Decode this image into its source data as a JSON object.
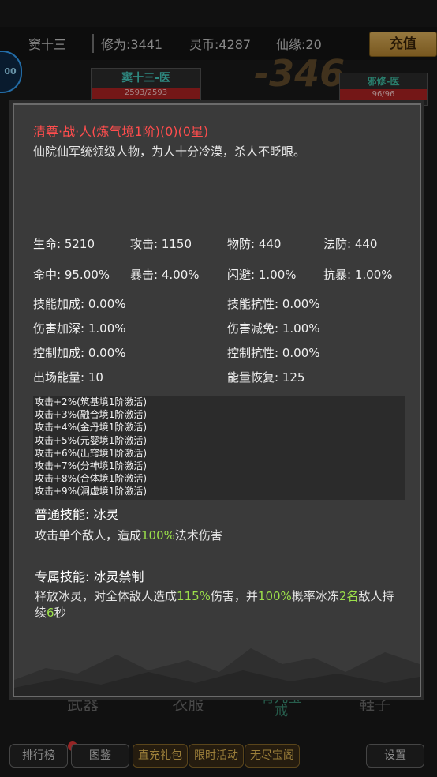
{
  "topbar": {
    "player_name": "窦十三",
    "cultivation": "修为:3441",
    "spirit_coins": "灵币:4287",
    "fate": "仙缘:20",
    "recharge_label": "充值"
  },
  "battle": {
    "round_badge": "00",
    "damage_number": "-346",
    "ally": {
      "name": "窦十三-医",
      "hp": "2593/2593"
    },
    "enemy": {
      "name": "邪修-医",
      "hp": "96/96"
    }
  },
  "bottom_tabs": [
    "武器",
    "衣服",
    "育儿宝戒",
    "鞋子"
  ],
  "bottom_bar": {
    "ranking": "排行榜",
    "codex": "图鉴",
    "gift": "直充礼包",
    "limited": "限时活动",
    "treasure": "无尽宝阁",
    "settings": "设置"
  },
  "detail": {
    "title": "清尊·战·人(炼气境1阶)(0)(0星)",
    "description": "仙院仙军统领级人物，为人十分冷漠，杀人不眨眼。",
    "stats_row1": [
      {
        "label": "生命",
        "value": "5210"
      },
      {
        "label": "攻击",
        "value": "1150"
      },
      {
        "label": "物防",
        "value": "440"
      },
      {
        "label": "法防",
        "value": "440"
      }
    ],
    "stats_row2": [
      {
        "label": "命中",
        "value": "95.00%"
      },
      {
        "label": "暴击",
        "value": "4.00%"
      },
      {
        "label": "闪避",
        "value": "1.00%"
      },
      {
        "label": "抗暴",
        "value": "1.00%"
      }
    ],
    "stats_pairs": [
      [
        {
          "label": "技能加成",
          "value": "0.00%"
        },
        {
          "label": "技能抗性",
          "value": "0.00%"
        }
      ],
      [
        {
          "label": "伤害加深",
          "value": "1.00%"
        },
        {
          "label": "伤害减免",
          "value": "1.00%"
        }
      ],
      [
        {
          "label": "控制加成",
          "value": "0.00%"
        },
        {
          "label": "控制抗性",
          "value": "0.00%"
        }
      ],
      [
        {
          "label": "出场能量",
          "value": "10"
        },
        {
          "label": "能量恢复",
          "value": "125"
        }
      ]
    ],
    "activations": [
      "攻击+2%(筑基境1阶激活)",
      "攻击+3%(融合境1阶激活)",
      "攻击+4%(金丹境1阶激活)",
      "攻击+5%(元婴境1阶激活)",
      "攻击+6%(出窍境1阶激活)",
      "攻击+7%(分神境1阶激活)",
      "攻击+8%(合体境1阶激活)",
      "攻击+9%(洞虚境1阶激活)"
    ],
    "normal_skill": {
      "title": "普通技能: 冰灵",
      "text_a": "攻击单个敌人，造成",
      "hl_1": "100%",
      "text_b": "法术伤害"
    },
    "exclusive_skill": {
      "title": "专属技能: 冰灵禁制",
      "text_a": "释放冰灵，对全体敌人造成",
      "hl_1": "115%",
      "text_b": "伤害，并",
      "hl_2": "100%",
      "text_c": "概率冰冻",
      "hl_3": "2名",
      "text_d": "敌人持续",
      "hl_4": "6",
      "text_e": "秒"
    }
  }
}
